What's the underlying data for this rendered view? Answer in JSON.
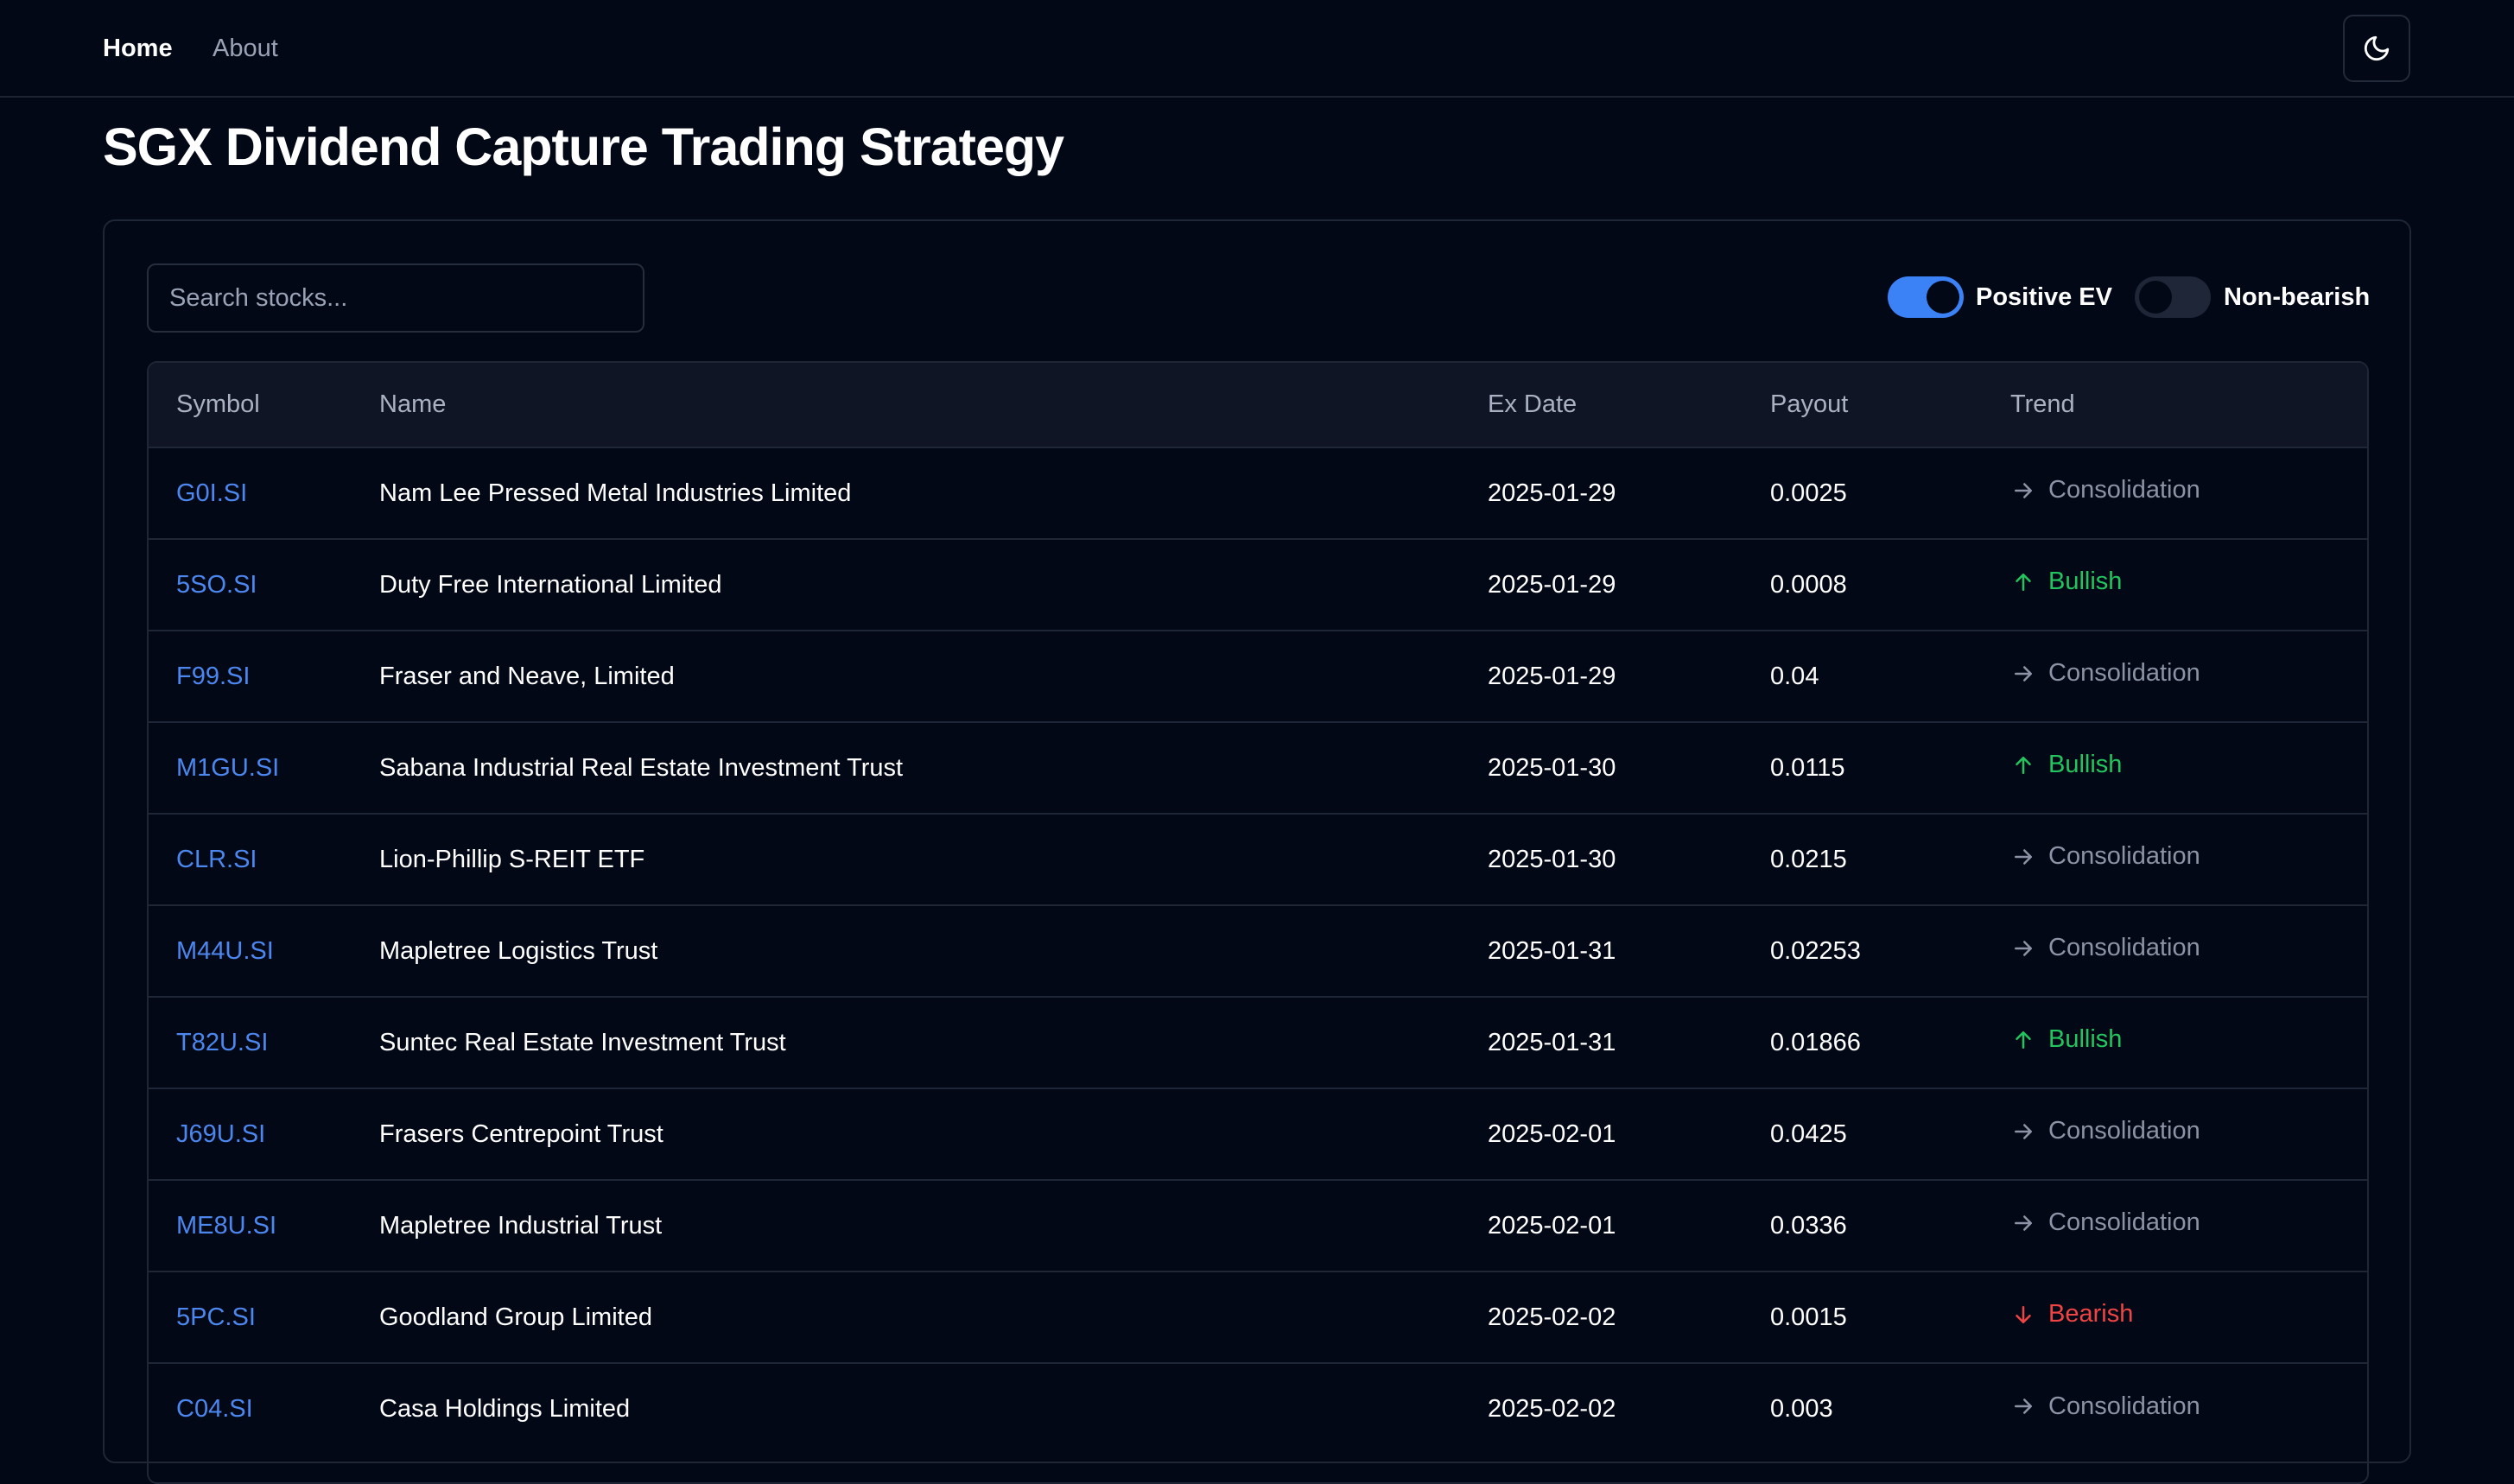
{
  "nav": {
    "home": "Home",
    "about": "About",
    "theme_icon": "moon-icon"
  },
  "page": {
    "title": "SGX Dividend Capture Trading Strategy"
  },
  "filters": {
    "search_placeholder": "Search stocks...",
    "search_value": "",
    "positive_ev": {
      "label": "Positive EV",
      "on": true
    },
    "non_bearish": {
      "label": "Non-bearish",
      "on": false
    }
  },
  "colors": {
    "accent": "#3b82f6",
    "symbol_link": "#4b87ee",
    "bullish": "#22c55e",
    "bearish": "#ef4444",
    "consolidation": "#8b93a5",
    "background": "#030816"
  },
  "table": {
    "headers": [
      "Symbol",
      "Name",
      "Ex Date",
      "Payout",
      "Trend"
    ],
    "rows": [
      {
        "symbol": "G0I.SI",
        "name": "Nam Lee Pressed Metal Industries Limited",
        "ex_date": "2025-01-29",
        "payout": "0.0025",
        "trend": "Consolidation"
      },
      {
        "symbol": "5SO.SI",
        "name": "Duty Free International Limited",
        "ex_date": "2025-01-29",
        "payout": "0.0008",
        "trend": "Bullish"
      },
      {
        "symbol": "F99.SI",
        "name": "Fraser and Neave, Limited",
        "ex_date": "2025-01-29",
        "payout": "0.04",
        "trend": "Consolidation"
      },
      {
        "symbol": "M1GU.SI",
        "name": "Sabana Industrial Real Estate Investment Trust",
        "ex_date": "2025-01-30",
        "payout": "0.0115",
        "trend": "Bullish"
      },
      {
        "symbol": "CLR.SI",
        "name": "Lion-Phillip S-REIT ETF",
        "ex_date": "2025-01-30",
        "payout": "0.0215",
        "trend": "Consolidation"
      },
      {
        "symbol": "M44U.SI",
        "name": "Mapletree Logistics Trust",
        "ex_date": "2025-01-31",
        "payout": "0.02253",
        "trend": "Consolidation"
      },
      {
        "symbol": "T82U.SI",
        "name": "Suntec Real Estate Investment Trust",
        "ex_date": "2025-01-31",
        "payout": "0.01866",
        "trend": "Bullish"
      },
      {
        "symbol": "J69U.SI",
        "name": "Frasers Centrepoint Trust",
        "ex_date": "2025-02-01",
        "payout": "0.0425",
        "trend": "Consolidation"
      },
      {
        "symbol": "ME8U.SI",
        "name": "Mapletree Industrial Trust",
        "ex_date": "2025-02-01",
        "payout": "0.0336",
        "trend": "Consolidation"
      },
      {
        "symbol": "5PC.SI",
        "name": "Goodland Group Limited",
        "ex_date": "2025-02-02",
        "payout": "0.0015",
        "trend": "Bearish"
      },
      {
        "symbol": "C04.SI",
        "name": "Casa Holdings Limited",
        "ex_date": "2025-02-02",
        "payout": "0.003",
        "trend": "Consolidation"
      }
    ]
  }
}
